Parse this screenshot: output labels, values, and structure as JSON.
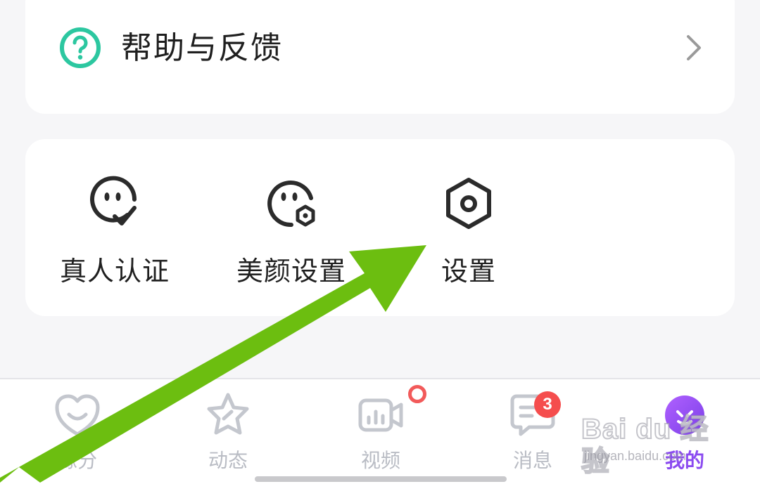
{
  "help": {
    "label": "帮助与反馈"
  },
  "tools": {
    "items": [
      {
        "label": "真人认证",
        "icon": "face-check-icon"
      },
      {
        "label": "美颜设置",
        "icon": "face-gear-icon"
      },
      {
        "label": "设置",
        "icon": "hexagon-gear-icon"
      }
    ]
  },
  "bottom_nav": {
    "items": [
      {
        "label": "缘分",
        "icon": "heart-smile-icon",
        "active": false
      },
      {
        "label": "动态",
        "icon": "star-icon",
        "active": false
      },
      {
        "label": "视频",
        "icon": "video-camera-icon",
        "active": false
      },
      {
        "label": "消息",
        "icon": "message-icon",
        "active": false,
        "badge": "3"
      },
      {
        "label": "我的",
        "icon": "profile-avatar-icon",
        "active": true
      }
    ]
  },
  "watermark": {
    "brand": "Bai du 经验",
    "site": "jingyan.baidu.com"
  },
  "colors": {
    "background": "#f6f6f8",
    "card": "#ffffff",
    "help_icon": "#2cc7a0",
    "icon_dark": "#2b2b2b",
    "nav_inactive": "#b9bcc4",
    "nav_active": "#8b4bf0",
    "badge": "#f54d4d",
    "annotation_arrow": "#6cbe10"
  }
}
